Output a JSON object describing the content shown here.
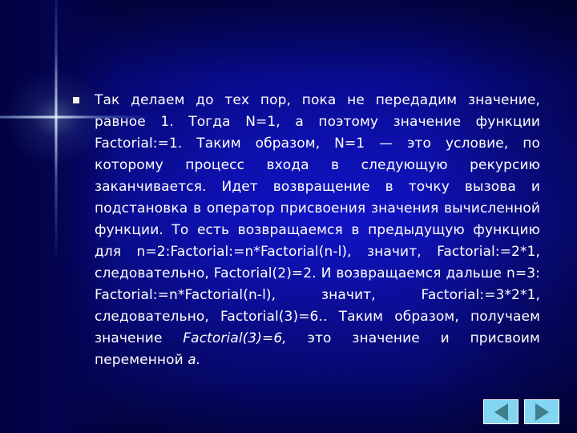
{
  "slide": {
    "background_color": "#00007a",
    "text_color": "#ffffff",
    "bullet": "square-bullet",
    "body": {
      "main": "Так делаем до тех пор, пока не передадим значение, равное 1. Тогда N=1, а поэтому значение функции Factorial:=1. Таким образом, N=1 — это условие, по которому процесс входа в следующую рекурсию заканчивается. Идет возвращение в точку вызова и подстановка в оператор присвоения значения вычисленной функции. То есть возвращаемся в предыдущую функцию для n=2:Factorial:=n*Factorial(n-l), значит, Factorial:=2*1, следовательно, Factorial(2)=2. И возвращаемся дальше n=3: Factorial:=n*Factorial(n-l), значит, Factorial:=3*2*1, следовательно, Factorial(3)=6.. Таким образом, получаем значение ",
      "emphasis_1": "Factorial(3)=6,",
      "after_emphasis_1": " это значение и присвоим переменной ",
      "emphasis_2": "a."
    }
  },
  "navigation": {
    "button_color": "#83d6f2",
    "arrow_color": "#3f7f8c",
    "previous": {
      "icon": "triangle-left-icon",
      "label": "Предыдущий слайд"
    },
    "next": {
      "icon": "triangle-right-icon",
      "label": "Следующий слайд"
    }
  }
}
